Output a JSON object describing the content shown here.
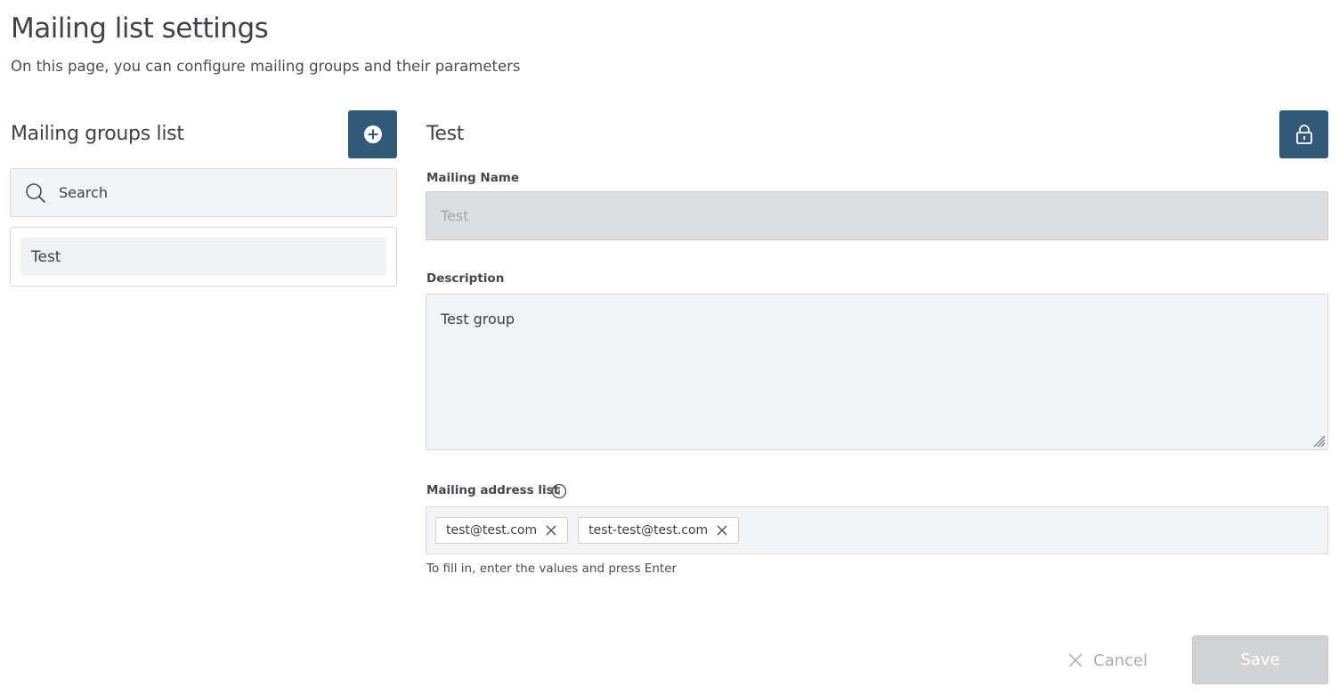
{
  "page": {
    "title": "Mailing list settings",
    "subtitle": "On this page, you can configure mailing groups and their parameters"
  },
  "groups": {
    "title": "Mailing groups list",
    "search_placeholder": "Search",
    "items": [
      {
        "label": "Test"
      }
    ]
  },
  "detail": {
    "title": "Test",
    "name_label": "Mailing Name",
    "name_value": "Test",
    "description_label": "Description",
    "description_value": "Test group",
    "address_label": "Mailing address list",
    "addresses": [
      {
        "value": "test@test.com"
      },
      {
        "value": "test-test@test.com"
      }
    ],
    "hint": "To fill in, enter the values and press Enter"
  },
  "actions": {
    "cancel_label": "Cancel",
    "save_label": "Save"
  },
  "colors": {
    "accent": "#325a78",
    "disabled": "#d1d3d5",
    "field_bg": "#f3f4f5"
  },
  "icons": {
    "add": "plus-circle-icon",
    "lock": "lock-icon",
    "search": "search-icon",
    "info": "info-icon",
    "tag_remove": "close-icon",
    "cancel": "close-icon"
  }
}
